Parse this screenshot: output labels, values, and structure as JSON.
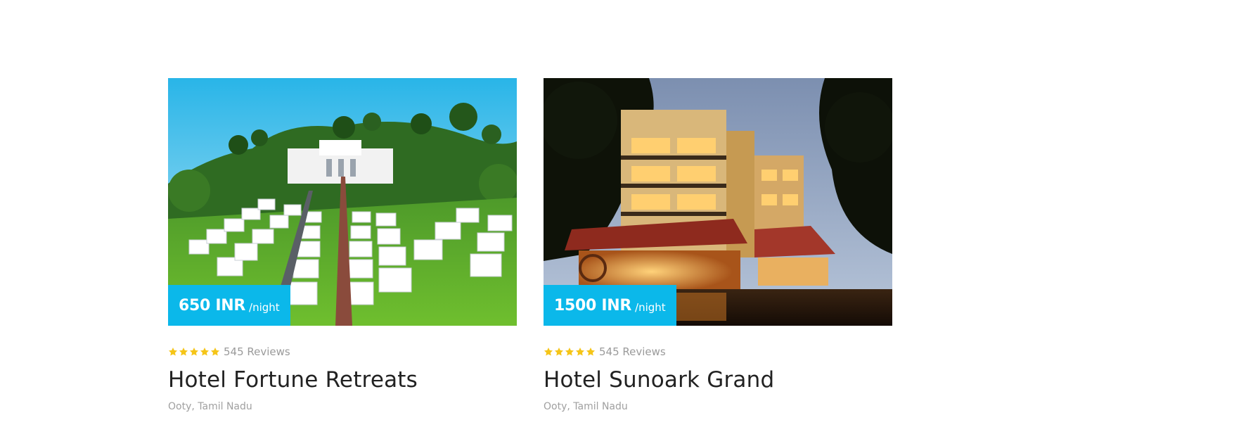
{
  "cards": [
    {
      "price_amount": "650 INR",
      "price_unit": "/night",
      "rating": 5,
      "reviews": "545 Reviews",
      "name": "Hotel Fortune Retreats",
      "location": "Ooty, Tamil Nadu",
      "photo": "hotel-fortune-retreats-photo"
    },
    {
      "price_amount": "1500 INR",
      "price_unit": "/night",
      "rating": 5,
      "reviews": "545 Reviews",
      "name": "Hotel Sunoark Grand",
      "location": "Ooty, Tamil Nadu",
      "photo": "hotel-sunoark-grand-photo"
    }
  ],
  "colors": {
    "price_tag": "#0bb8ea",
    "star": "#f5c518"
  }
}
